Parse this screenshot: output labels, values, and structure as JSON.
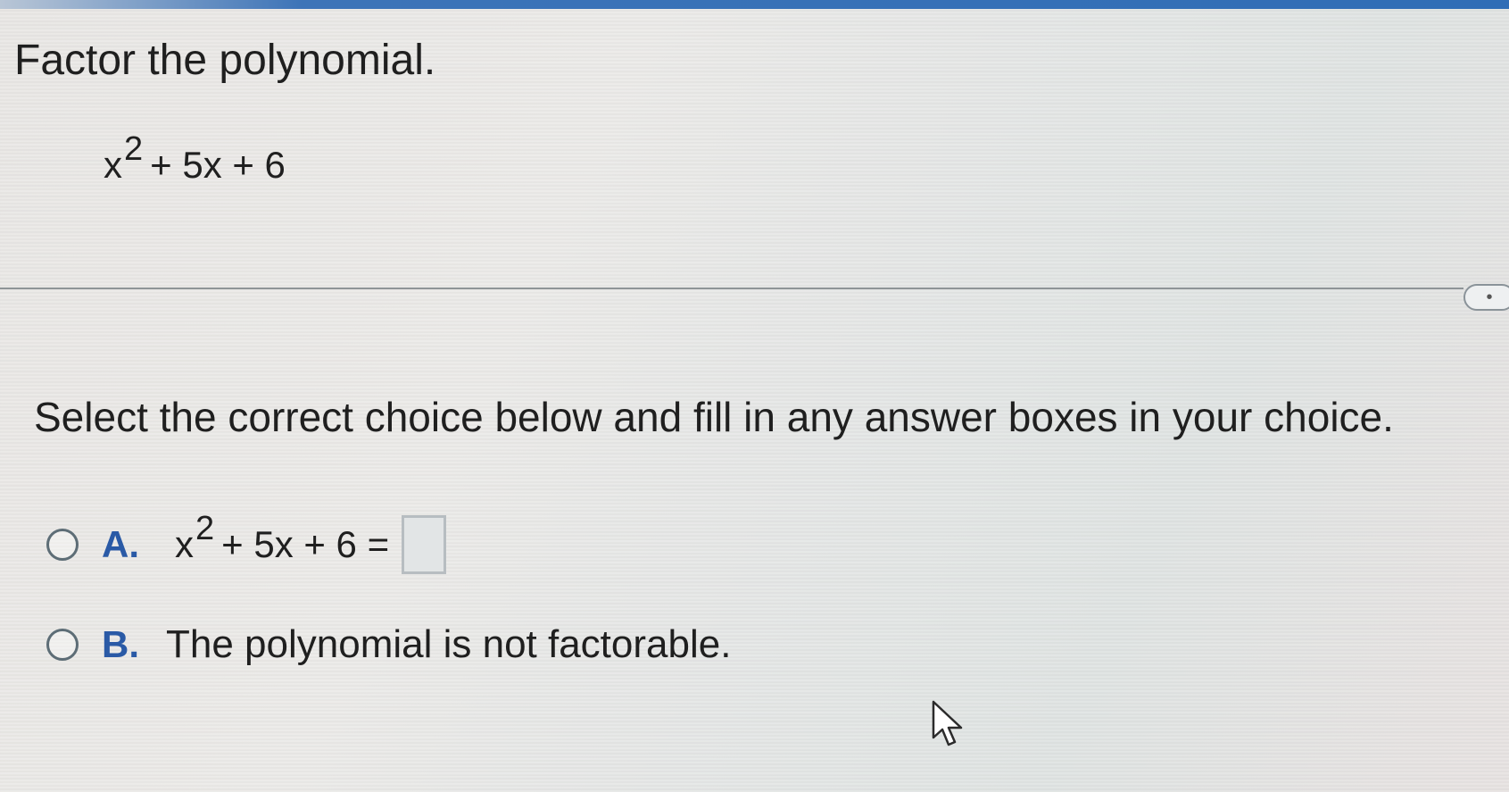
{
  "question": {
    "title": "Factor the polynomial.",
    "polynomial": {
      "base": "x",
      "exponent": "2",
      "rest": "+ 5x + 6"
    }
  },
  "more_handle": {
    "label": "•"
  },
  "instruction": "Select the correct choice below and fill in any answer boxes in your choice.",
  "choices": [
    {
      "letter": "A.",
      "expr_base": "x",
      "expr_exponent": "2",
      "expr_rest": "+ 5x + 6 =",
      "answer_value": ""
    },
    {
      "letter": "B.",
      "text": "The polynomial is not factorable."
    }
  ],
  "colors": {
    "accent": "#2f6db6",
    "choice_letter": "#2a5aa6"
  },
  "icons": {
    "cursor": "mouse-pointer-icon",
    "radio": "radio-button-icon"
  }
}
